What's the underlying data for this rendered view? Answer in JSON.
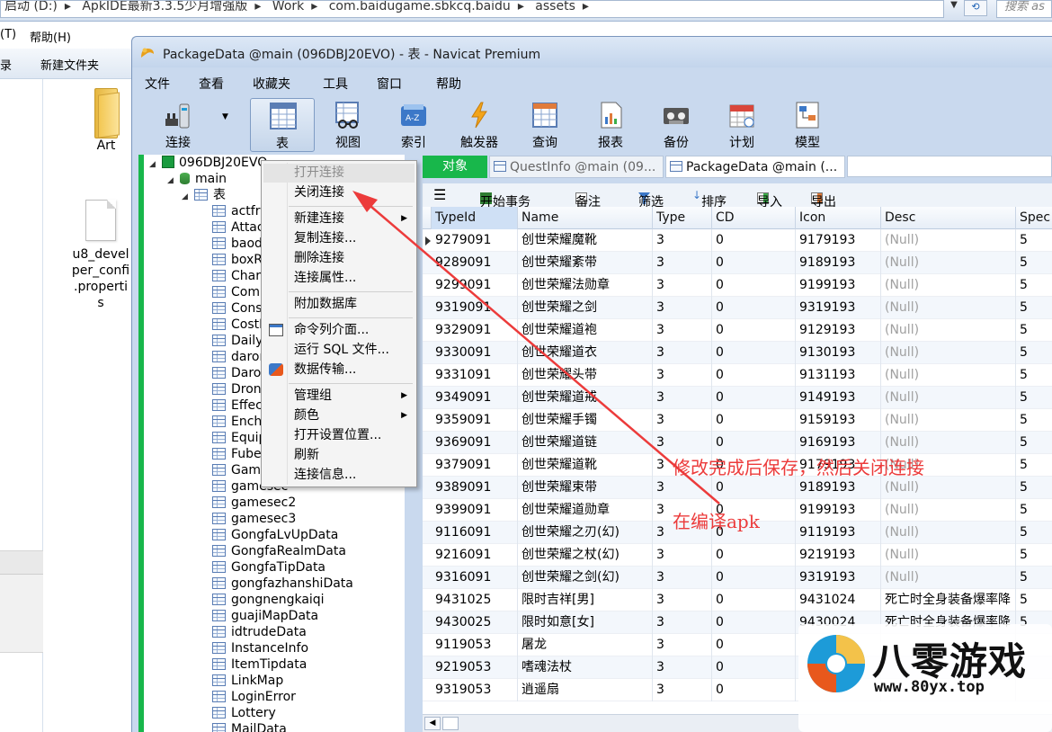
{
  "explorer": {
    "address_parts": [
      "启动 (D:)",
      "ApkIDE最新3.3.5少月增强版",
      "Work",
      "com.baidugame.sbkcq.baidu",
      "assets"
    ],
    "search_placeholder": "搜索 as",
    "menu": [
      "(T)",
      "帮助(H)"
    ],
    "cmd": [
      "录",
      "新建文件夹"
    ],
    "files": [
      {
        "name": "Art",
        "type": "folder"
      },
      {
        "name": "u8_developer_config.properties",
        "line1": "u8_devel",
        "line2": "per_confi",
        "line3": ".properti",
        "line4": "s",
        "type": "file"
      }
    ]
  },
  "window": {
    "title": "PackageData @main (096DBJ20EVO) - 表 - Navicat Premium",
    "menu": [
      "文件",
      "查看",
      "收藏夹",
      "工具",
      "窗口",
      "帮助"
    ],
    "toolbar": [
      {
        "label": "连接",
        "icon": "plug-icon"
      },
      {
        "label": "表",
        "icon": "table-icon",
        "active": true
      },
      {
        "label": "视图",
        "icon": "view-icon"
      },
      {
        "label": "索引",
        "icon": "index-icon"
      },
      {
        "label": "触发器",
        "icon": "lightning-icon"
      },
      {
        "label": "查询",
        "icon": "query-icon"
      },
      {
        "label": "报表",
        "icon": "report-icon"
      },
      {
        "label": "备份",
        "icon": "backup-icon"
      },
      {
        "label": "计划",
        "icon": "calendar-icon"
      },
      {
        "label": "模型",
        "icon": "model-icon"
      }
    ]
  },
  "tree": {
    "connection": "096DBJ20EVO",
    "database": "main",
    "tables_node": "表",
    "tables": [
      "actfra",
      "Attac",
      "baod",
      "boxR",
      "Charc",
      "Comp",
      "Cons",
      "CostI",
      "Daily",
      "daror",
      "Daror",
      "Dron",
      "Effect",
      "Encha",
      "Equip",
      "Fube",
      "Game",
      "gamesec",
      "gamesec2",
      "gamesec3",
      "GongfaLvUpData",
      "GongfaRealmData",
      "GongfaTipData",
      "gongfazhanshiData",
      "gongnengkaiqi",
      "guajiMapData",
      "idtrudeData",
      "InstanceInfo",
      "ItemTipdata",
      "LinkMap",
      "LoginError",
      "Lottery",
      "MailData"
    ]
  },
  "context_menu": {
    "items": [
      {
        "label": "打开连接",
        "disabled": true
      },
      {
        "label": "关闭连接"
      },
      {
        "sep": true
      },
      {
        "label": "新建连接",
        "submenu": true
      },
      {
        "label": "复制连接..."
      },
      {
        "label": "删除连接"
      },
      {
        "label": "连接属性..."
      },
      {
        "sep": true
      },
      {
        "label": "附加数据库"
      },
      {
        "sep": true
      },
      {
        "label": "命令列介面...",
        "icon": "console-icon"
      },
      {
        "label": "运行 SQL 文件..."
      },
      {
        "label": "数据传输...",
        "icon": "transfer-icon"
      },
      {
        "sep": true
      },
      {
        "label": "管理组",
        "submenu": true
      },
      {
        "label": "颜色",
        "submenu": true
      },
      {
        "label": "打开设置位置..."
      },
      {
        "label": "刷新"
      },
      {
        "label": "连接信息..."
      }
    ]
  },
  "tabs": {
    "objects": "对象",
    "questinfo": "QuestInfo @main (09...",
    "packagedata": "PackageData @main (..."
  },
  "data_toolbar": {
    "menu": "☰",
    "begin_tx": "开始事务",
    "note": "备注",
    "filter": "筛选",
    "sort": "排序",
    "import": "导入",
    "export": "导出"
  },
  "grid": {
    "columns": [
      "TypeId",
      "Name",
      "Type",
      "CD",
      "Icon",
      "Desc",
      "Spec"
    ],
    "null_label": "(Null)",
    "rows": [
      [
        "9279091",
        "创世荣耀魔靴",
        "3",
        "0",
        "9179193",
        null,
        "5"
      ],
      [
        "9289091",
        "创世荣耀紊带",
        "3",
        "0",
        "9189193",
        null,
        "5"
      ],
      [
        "9299091",
        "创世荣耀法勋章",
        "3",
        "0",
        "9199193",
        null,
        "5"
      ],
      [
        "9319091",
        "创世荣耀之剑",
        "3",
        "0",
        "9319193",
        null,
        "5"
      ],
      [
        "9329091",
        "创世荣耀道袍",
        "3",
        "0",
        "9129193",
        null,
        "5"
      ],
      [
        "9330091",
        "创世荣耀道衣",
        "3",
        "0",
        "9130193",
        null,
        "5"
      ],
      [
        "9331091",
        "创世荣耀头带",
        "3",
        "0",
        "9131193",
        null,
        "5"
      ],
      [
        "9349091",
        "创世荣耀道戒",
        "3",
        "0",
        "9149193",
        null,
        "5"
      ],
      [
        "9359091",
        "创世荣耀手镯",
        "3",
        "0",
        "9159193",
        null,
        "5"
      ],
      [
        "9369091",
        "创世荣耀道链",
        "3",
        "0",
        "9169193",
        null,
        "5"
      ],
      [
        "9379091",
        "创世荣耀道靴",
        "3",
        "0",
        "9179193",
        null,
        "5"
      ],
      [
        "9389091",
        "创世荣耀束带",
        "3",
        "0",
        "9189193",
        null,
        "5"
      ],
      [
        "9399091",
        "创世荣耀道勋章",
        "3",
        "0",
        "9199193",
        null,
        "5"
      ],
      [
        "9116091",
        "创世荣耀之刃(幻)",
        "3",
        "0",
        "9119193",
        null,
        "5"
      ],
      [
        "9216091",
        "创世荣耀之杖(幻)",
        "3",
        "0",
        "9219193",
        null,
        "5"
      ],
      [
        "9316091",
        "创世荣耀之剑(幻)",
        "3",
        "0",
        "9319193",
        null,
        "5"
      ],
      [
        "9431025",
        "限时吉祥[男]",
        "3",
        "0",
        "9431024",
        "死亡时全身装备爆率降",
        "5"
      ],
      [
        "9430025",
        "限时如意[女]",
        "3",
        "0",
        "9430024",
        "死亡时全身装备爆率降",
        "5"
      ],
      [
        "9119053",
        "屠龙",
        "3",
        "0",
        "",
        "",
        ""
      ],
      [
        "9219053",
        "嗜魂法杖",
        "3",
        "0",
        "",
        "",
        ""
      ],
      [
        "9319053",
        "逍遥扇",
        "3",
        "0",
        "",
        "",
        ""
      ]
    ]
  },
  "annotations": {
    "line1": "修改完成后保存，然后关闭连接",
    "line2": "在编译apk",
    "color": "#ec3b3b"
  },
  "watermark": {
    "title": "八零游戏",
    "url": "www.80yx.top"
  }
}
